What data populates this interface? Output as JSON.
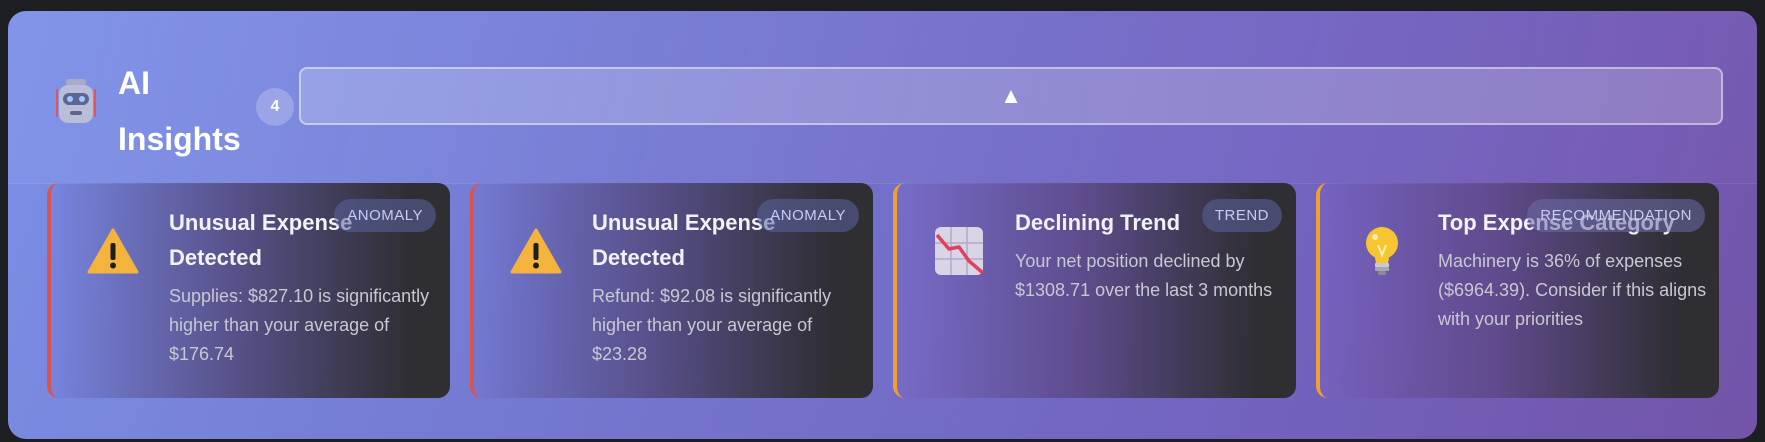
{
  "header": {
    "title": "AI Insights",
    "count": "4",
    "toggle_glyph": "▲",
    "robot_icon": "robot-icon"
  },
  "colors": {
    "anomaly_accent": "#d9534f",
    "trend_accent": "#f0a030",
    "panel_start": "#7b8fe6",
    "panel_end": "#7254a8"
  },
  "cards": [
    {
      "icon": "warning-icon",
      "tag": "ANOMALY",
      "title": "Unusual Expense Detected",
      "description": "Supplies: $827.10 is significantly higher than your average of $176.74"
    },
    {
      "icon": "warning-icon",
      "tag": "ANOMALY",
      "title": "Unusual Expense Detected",
      "description": "Refund: $92.08 is significantly higher than your average of $23.28"
    },
    {
      "icon": "chart-decreasing-icon",
      "tag": "TREND",
      "title": "Declining Trend",
      "description": "Your net position declined by $1308.71 over the last 3 months"
    },
    {
      "icon": "lightbulb-icon",
      "tag": "RECOMMENDATION",
      "title": "Top Expense Category",
      "description": "Machinery is 36% of expenses ($6964.39). Consider if this aligns with your priorities"
    }
  ]
}
